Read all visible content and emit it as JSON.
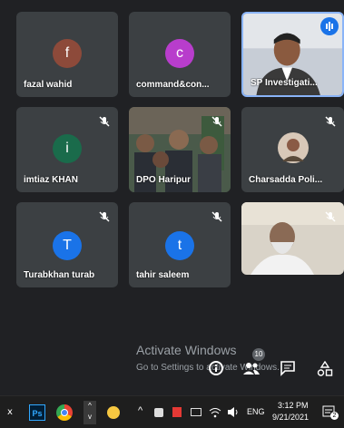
{
  "participants": [
    {
      "name": "fazal wahid",
      "initial": "f",
      "avatar_color": "#8d4a3a",
      "muted": false
    },
    {
      "name": "command&con...",
      "initial": "c",
      "avatar_color": "#b83dcc",
      "muted": false
    },
    {
      "name": "SP Investigati...",
      "initial": "",
      "muted": false,
      "speaking": true,
      "video": true
    },
    {
      "name": "imtiaz KHAN",
      "initial": "i",
      "avatar_color": "#1a6b4b",
      "muted": true
    },
    {
      "name": "DPO Haripur",
      "initial": "",
      "muted": true,
      "video": true
    },
    {
      "name": "Charsadda Poli...",
      "initial": "",
      "muted": true,
      "video": false,
      "photo_avatar": true
    },
    {
      "name": "Turabkhan turab",
      "initial": "T",
      "avatar_color": "#1a73e8",
      "muted": true
    },
    {
      "name": "tahir saleem",
      "initial": "t",
      "avatar_color": "#1a73e8",
      "muted": true
    },
    {
      "name": "",
      "initial": "",
      "muted": true,
      "video": true
    }
  ],
  "watermark": {
    "title": "Activate Windows",
    "subtitle": "Go to Settings to activate Windows."
  },
  "meeting_controls": {
    "participants_count": "10"
  },
  "taskbar": {
    "language": "ENG",
    "time": "3:12 PM",
    "date": "9/21/2021",
    "notification_count": "2"
  },
  "colors": {
    "accent": "#1a73e8",
    "tile": "#3c4043",
    "background": "#202124"
  }
}
